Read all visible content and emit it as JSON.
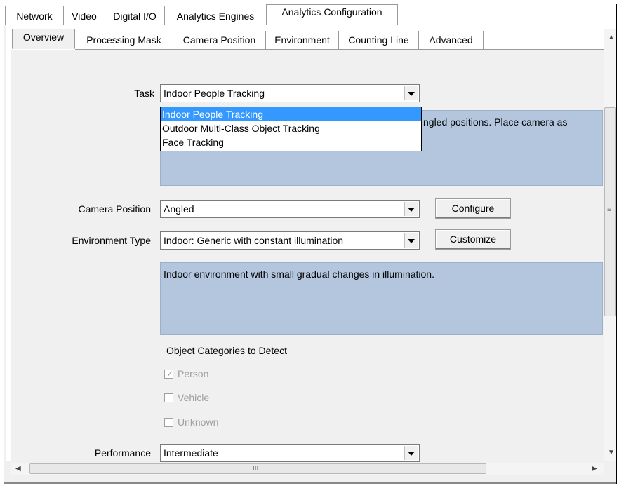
{
  "main_tabs": [
    "Network",
    "Video",
    "Digital I/O",
    "Analytics Engines",
    "Analytics Configuration"
  ],
  "sub_tabs": [
    "Overview",
    "Processing Mask",
    "Camera Position",
    "Environment",
    "Counting Line",
    "Advanced"
  ],
  "task": {
    "label": "Task",
    "value": "Indoor People Tracking",
    "options": [
      "Indoor People Tracking",
      "Outdoor Multi-Class Object Tracking",
      "Face Tracking"
    ],
    "description_visible": "ngled positions.  Place camera as"
  },
  "camera_position": {
    "label": "Camera Position",
    "value": "Angled",
    "button": "Configure"
  },
  "environment": {
    "label": "Environment Type",
    "value": "Indoor: Generic with constant illumination",
    "button": "Customize",
    "description": "Indoor environment with small gradual changes in illumination."
  },
  "object_categories": {
    "title": "Object Categories to Detect",
    "items": [
      {
        "label": "Person",
        "checked": true
      },
      {
        "label": "Vehicle",
        "checked": false
      },
      {
        "label": "Unknown",
        "checked": false
      }
    ]
  },
  "performance": {
    "label": "Performance",
    "value": "Intermediate"
  },
  "scrollbar": {
    "grip_glyph": "≡",
    "h_grip_glyph": "III"
  },
  "colors": {
    "selection": "#3399ff",
    "description_bg": "#b3c6de"
  }
}
